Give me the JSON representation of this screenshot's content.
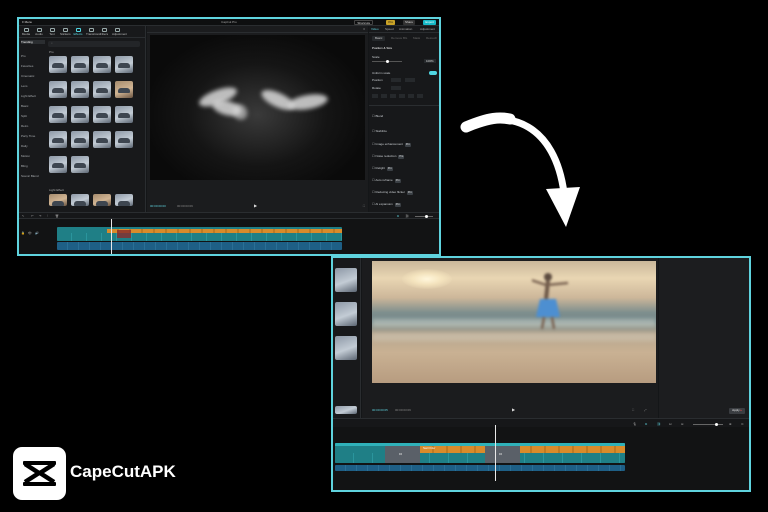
{
  "screenshot1": {
    "window_title": "CapCut Pro",
    "top_right": {
      "shortcuts": "Shortcuts",
      "pro": "Pro",
      "share": "Share",
      "export": "Export"
    },
    "tools": [
      "Media",
      "Audio",
      "Text",
      "Stickers",
      "Effects",
      "Transitions",
      "Filters",
      "Adjustment"
    ],
    "active_tool": "Effects",
    "categories": [
      "Trending",
      "Pro",
      "Favorites",
      "Cinematic",
      "Lens",
      "Light Effect",
      "Basic",
      "Split",
      "Retro",
      "Party Time",
      "Daily",
      "Motion",
      "Bling",
      "Scenic Blend"
    ],
    "section_labels": {
      "first": "Pro",
      "second": "Light Effect"
    },
    "player_title": "Player",
    "player_time": {
      "current": "00:00:00:00",
      "total": "00:00:03:09"
    },
    "right_tabs": [
      "Video",
      "Speed",
      "Animation",
      "Adjustment"
    ],
    "right_subtabs": [
      "Basic",
      "Remove BG",
      "Mask",
      "Retouch"
    ],
    "props": {
      "position_size": "Position & Size",
      "scale": "Scale",
      "scale_value": "100%",
      "uniform_scale": "Uniform scale",
      "position": "Position",
      "rotate": "Rotate",
      "blend": "Blend",
      "stabilize": "Stabilize",
      "image_enhancement": "Image enhancement",
      "noise_reduction": "Noise reduction",
      "relight": "Relight",
      "auto_reframe": "Auto reframe",
      "reduce_flicker": "Reducing video flicker",
      "ai_expansion": "AI expansion",
      "badge": "Pro"
    }
  },
  "screenshot2": {
    "player_time": {
      "current": "00:00:00:05",
      "total": "00:00:03:09"
    },
    "apply_label": "Apply",
    "clip_label": "Swirl blur"
  },
  "brand": {
    "name": "CapeCutAPK"
  },
  "colors": {
    "accent": "#5fd3de",
    "frame": "#5fd3de",
    "background": "#000000",
    "clip_teal": "#1f7f86",
    "clip_orange": "#d98b2b",
    "clip_blue": "#1e5f86"
  }
}
